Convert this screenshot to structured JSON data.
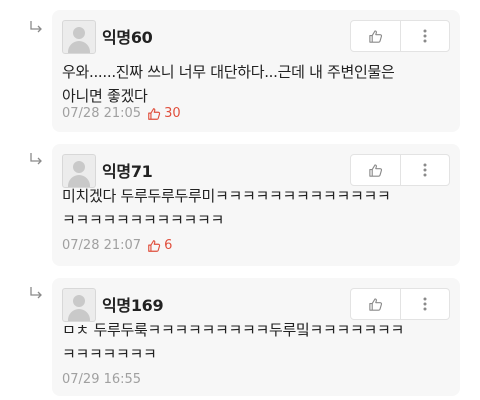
{
  "comments": [
    {
      "name": "익명60",
      "line1": "우와......진짜 쓰니 너무 대단하다...근데 내 주변인물은",
      "line2": "아니면 좋겠다",
      "time": "07/28 21:05",
      "likes": "30"
    },
    {
      "name": "익명71",
      "line1": "미치겠다 두루두루두루미ㅋㅋㅋㅋㅋㅋㅋㅋㅋㅋㅋㅋㅋ",
      "line2": "ㅋㅋㅋㅋㅋㅋㅋㅋㅋㅋㅋㅋ",
      "time": "07/28 21:07",
      "likes": "6"
    },
    {
      "name": "익명169",
      "line1": "ㅁㅊ 두루두룩ㅋㅋㅋㅋㅋㅋㅋㅋㅋ두루밐ㅋㅋㅋㅋㅋㅋㅋ",
      "line2": "ㅋㅋㅋㅋㅋㅋㅋ",
      "time": "07/29 16:55",
      "likes": ""
    }
  ],
  "icons": {
    "reply": "reply-arrow-icon",
    "like": "thumbs-up-icon",
    "more": "more-vertical-icon",
    "avatar": "default-avatar-icon"
  },
  "colors": {
    "card_bg": "#f7f7f7",
    "like_accent": "#e0503e",
    "meta_text": "#a0a0a0"
  }
}
